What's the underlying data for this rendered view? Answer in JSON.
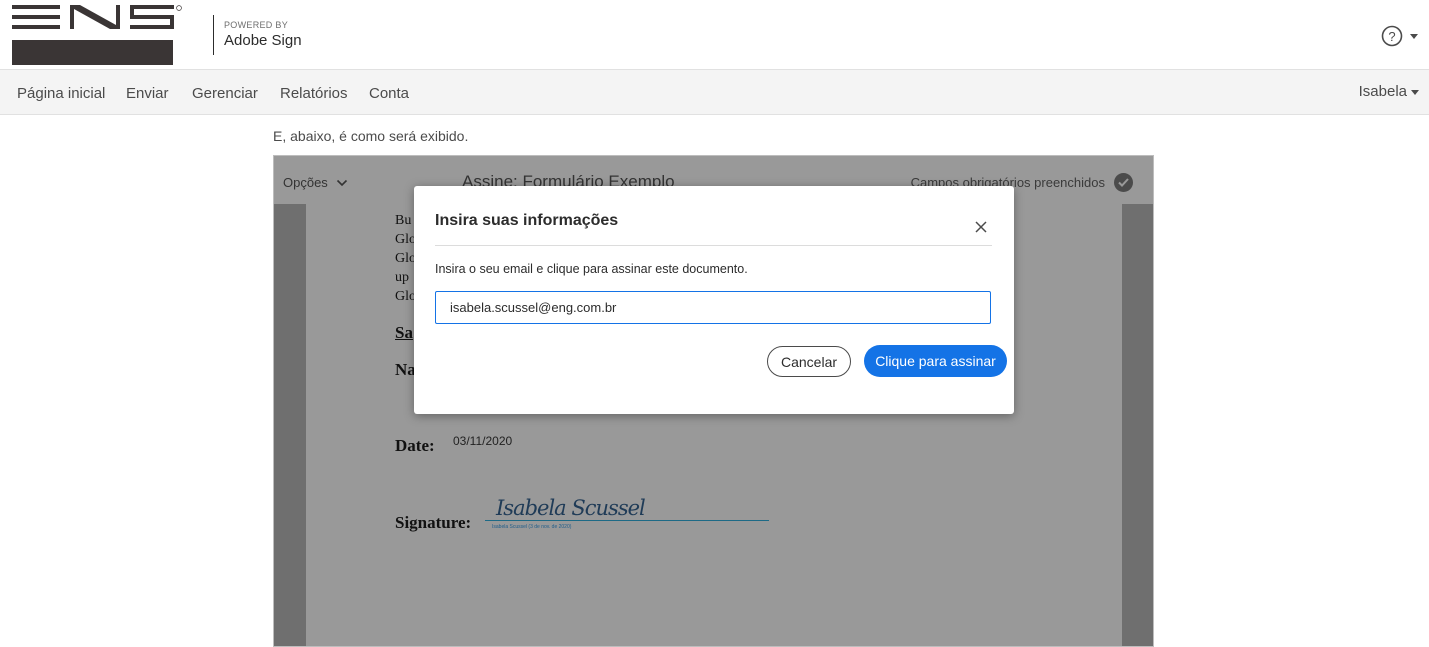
{
  "header": {
    "logo_alt": "ENG",
    "powered_by": "POWERED BY",
    "brand": "Adobe Sign",
    "help_icon": "help-circle-icon"
  },
  "nav": {
    "items": [
      "Página inicial",
      "Enviar",
      "Gerenciar",
      "Relatórios",
      "Conta"
    ],
    "user": "Isabela"
  },
  "caption": "E, abaixo, é como será exibido.",
  "document": {
    "options_label": "Opções",
    "title": "Assine: Formulário Exemplo",
    "required_status": "Campos obrigatórios preenchidos",
    "text_lines": [
      "Bu",
      "Glo",
      "Glo",
      "up",
      "Glo"
    ],
    "section_heading": "Sa",
    "name_label": "Na",
    "date_label": "Date:",
    "date_value": "03/11/2020",
    "signature_label": "Signature:",
    "signature_script": "Isabela Scussel",
    "signature_subtext": "Isabela Scussel    (3 de nov. de 2020)"
  },
  "modal": {
    "title": "Insira suas informações",
    "description": "Insira o seu email e clique para assinar este documento.",
    "email_value": "isabela.scussel@eng.com.br",
    "cancel_label": "Cancelar",
    "sign_label": "Clique para assinar"
  },
  "colors": {
    "primary": "#1473e6",
    "overlay_bar": "#999999",
    "nav_bg": "#f4f4f4"
  }
}
